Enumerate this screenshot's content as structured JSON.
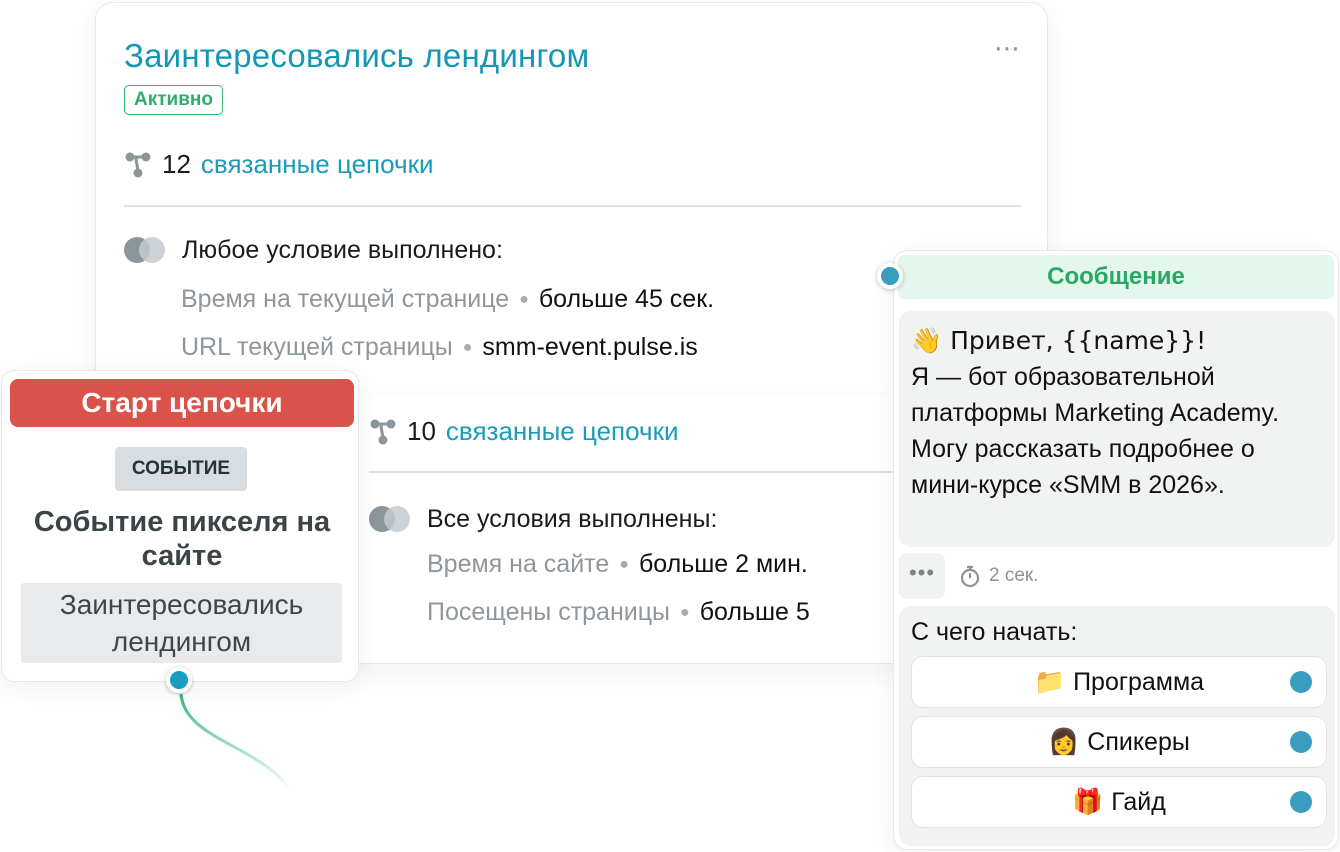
{
  "segment": {
    "title": "Заинтересовались лендингом",
    "status": "Активно",
    "more_icon": "⋯",
    "chains_count": "12",
    "chains_label": "связанные цепочки",
    "condition_any": "Любое условие выполнено:",
    "rows_any": [
      {
        "key": "Время на текущей странице",
        "value": "больше 45 сек."
      },
      {
        "key": "URL текущей страницы",
        "value": "smm-event.pulse.is"
      }
    ],
    "chains2_count": "10",
    "chains2_label": "связанные цепочки",
    "condition_all": "Все условия выполнены:",
    "rows_all": [
      {
        "key": "Время на сайте",
        "value": "больше 2 мин."
      },
      {
        "key": "Посещены страницы",
        "value": "больше 5"
      }
    ]
  },
  "start": {
    "header": "Старт цепочки",
    "tag": "СОБЫТИЕ",
    "title": "Событие пикселя на сайте",
    "value": "Заинтересовались лендингом"
  },
  "message": {
    "header": "Сообщение",
    "text_line1": "👋 Привет, {{name}}!",
    "text_body": "Я — бот образовательной платформы Marketing Academy. Могу рассказать подробнее о мини-курсе «SMM в 2026».",
    "delay": "2 сек.",
    "question": "С чего начать:",
    "buttons": [
      {
        "icon": "📁",
        "label": "Программа"
      },
      {
        "icon": "👩",
        "label": "Спикеры"
      },
      {
        "icon": "🎁",
        "label": "Гайд"
      }
    ]
  },
  "colors": {
    "accent": "#1597b4",
    "start_red": "#d9534a",
    "active_green": "#2fae6b",
    "port_blue": "#1a9fc2"
  }
}
